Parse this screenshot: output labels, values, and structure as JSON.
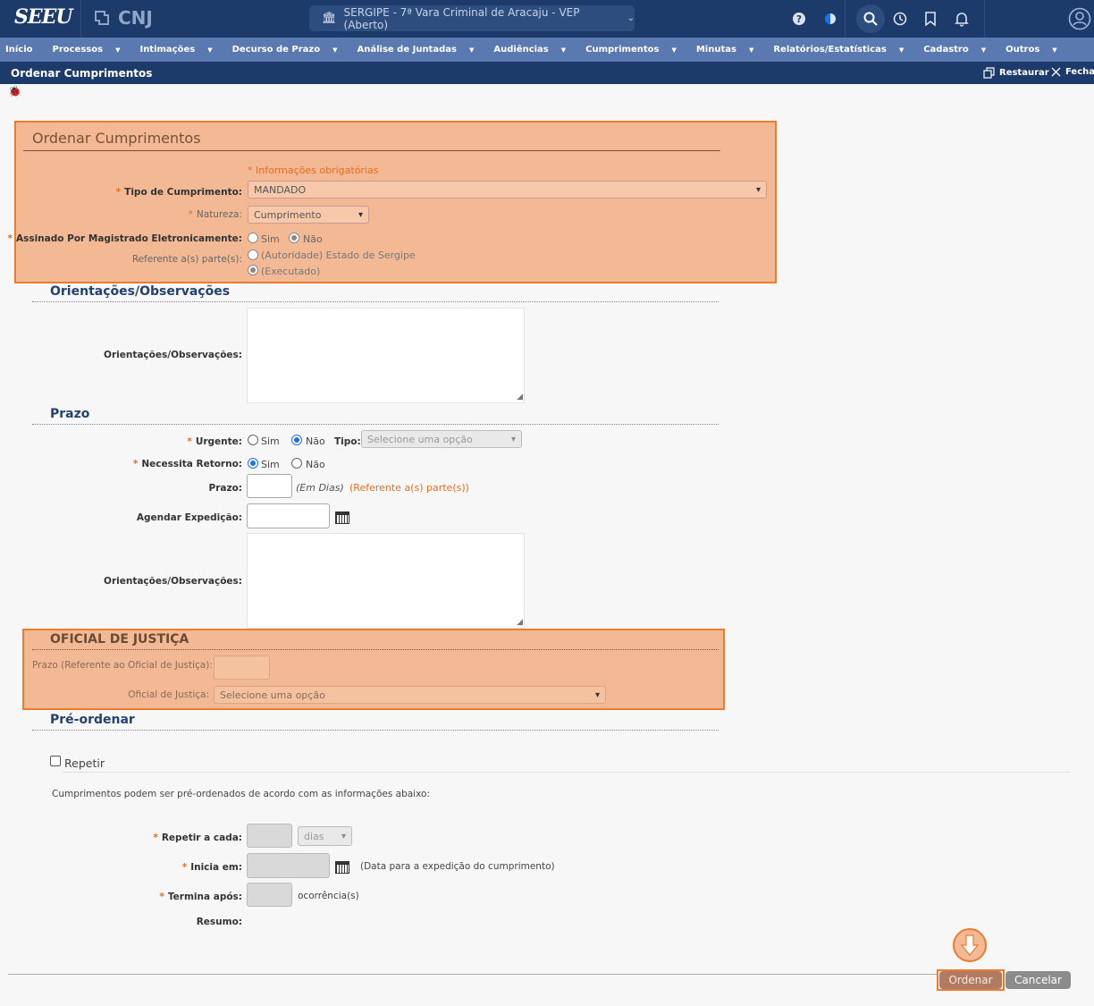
{
  "header": {
    "logo_text": "SEEU",
    "cnj_text": "CNJ",
    "court_selector": "SERGIPE - 7ª Vara Criminal de Aracaju - VEP (Aberto)"
  },
  "menu": [
    "Início",
    "Processos",
    "Intimações",
    "Decurso de Prazo",
    "Análise de Juntadas",
    "Audiências",
    "Cumprimentos",
    "Minutas",
    "Relatórios/Estatísticas",
    "Cadastro",
    "Outros"
  ],
  "titlebar": {
    "title": "Ordenar Cumprimentos",
    "restore": "Restaurar",
    "close": "Fechar"
  },
  "form": {
    "heading": "Ordenar Cumprimentos",
    "required_note": "* Informações obrigatórias",
    "tipo_label": "Tipo de Cumprimento:",
    "tipo_value": "MANDADO",
    "natureza_label": "Natureza:",
    "natureza_value": "Cumprimento",
    "assinado_label": "Assinado Por Magistrado Eletronicamente:",
    "sim": "Sim",
    "nao": "Não",
    "referente_label": "Referente a(s) parte(s):",
    "parte1": "(Autoridade) Estado de Sergipe",
    "parte2": "(Executado)"
  },
  "orientacoes": {
    "title": "Orientações/Observações",
    "label": "Orientações/Observações:"
  },
  "prazo": {
    "title": "Prazo",
    "urgente_label": "Urgente:",
    "tipo_label": "Tipo:",
    "tipo_placeholder": "Selecione uma opção",
    "retorno_label": "Necessita Retorno:",
    "prazo_label": "Prazo:",
    "em_dias": "(Em Dias)",
    "referente_link": "(Referente a(s) parte(s))",
    "agendar_label": "Agendar Expedição:",
    "obs_label": "Orientações/Observações:"
  },
  "oficial": {
    "title": "OFICIAL DE JUSTIÇA",
    "prazo_label": "Prazo (Referente ao Oficial de Justiça):",
    "oficial_label": "Oficial de Justiça:",
    "oficial_placeholder": "Selecione uma opção"
  },
  "preordenar": {
    "title": "Pré-ordenar",
    "repetir": "Repetir",
    "info": "Cumprimentos podem ser pré-ordenados de acordo com as informações abaixo:",
    "repetir_cada_label": "Repetir a cada:",
    "dias": "dias",
    "inicia_label": "Inicia em:",
    "inicia_hint": "(Data para a expedição do cumprimento)",
    "termina_label": "Termina após:",
    "ocorrencias": "ocorrência(s)",
    "resumo_label": "Resumo:"
  },
  "buttons": {
    "ordenar": "Ordenar",
    "cancelar": "Cancelar"
  },
  "colors": {
    "header": "#1d3b6a",
    "menubar": "#5a79b0",
    "highlight": "#f2b994",
    "highlight_border": "#ec7b30"
  }
}
